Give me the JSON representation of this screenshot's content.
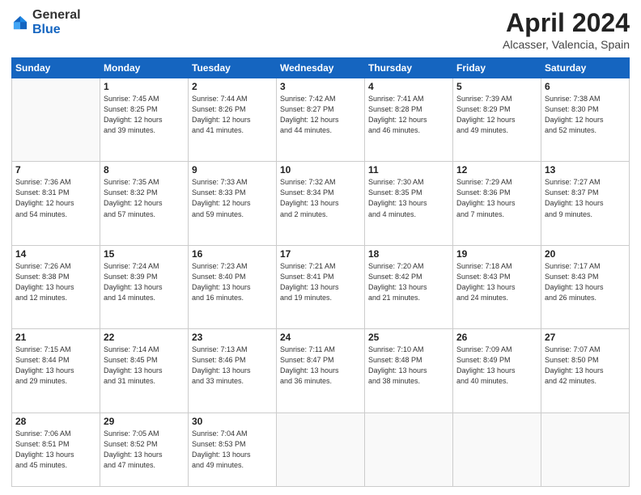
{
  "header": {
    "logo_general": "General",
    "logo_blue": "Blue",
    "month_title": "April 2024",
    "location": "Alcasser, Valencia, Spain"
  },
  "columns": [
    "Sunday",
    "Monday",
    "Tuesday",
    "Wednesday",
    "Thursday",
    "Friday",
    "Saturday"
  ],
  "weeks": [
    [
      {
        "num": "",
        "info": ""
      },
      {
        "num": "1",
        "info": "Sunrise: 7:45 AM\nSunset: 8:25 PM\nDaylight: 12 hours\nand 39 minutes."
      },
      {
        "num": "2",
        "info": "Sunrise: 7:44 AM\nSunset: 8:26 PM\nDaylight: 12 hours\nand 41 minutes."
      },
      {
        "num": "3",
        "info": "Sunrise: 7:42 AM\nSunset: 8:27 PM\nDaylight: 12 hours\nand 44 minutes."
      },
      {
        "num": "4",
        "info": "Sunrise: 7:41 AM\nSunset: 8:28 PM\nDaylight: 12 hours\nand 46 minutes."
      },
      {
        "num": "5",
        "info": "Sunrise: 7:39 AM\nSunset: 8:29 PM\nDaylight: 12 hours\nand 49 minutes."
      },
      {
        "num": "6",
        "info": "Sunrise: 7:38 AM\nSunset: 8:30 PM\nDaylight: 12 hours\nand 52 minutes."
      }
    ],
    [
      {
        "num": "7",
        "info": "Sunrise: 7:36 AM\nSunset: 8:31 PM\nDaylight: 12 hours\nand 54 minutes."
      },
      {
        "num": "8",
        "info": "Sunrise: 7:35 AM\nSunset: 8:32 PM\nDaylight: 12 hours\nand 57 minutes."
      },
      {
        "num": "9",
        "info": "Sunrise: 7:33 AM\nSunset: 8:33 PM\nDaylight: 12 hours\nand 59 minutes."
      },
      {
        "num": "10",
        "info": "Sunrise: 7:32 AM\nSunset: 8:34 PM\nDaylight: 13 hours\nand 2 minutes."
      },
      {
        "num": "11",
        "info": "Sunrise: 7:30 AM\nSunset: 8:35 PM\nDaylight: 13 hours\nand 4 minutes."
      },
      {
        "num": "12",
        "info": "Sunrise: 7:29 AM\nSunset: 8:36 PM\nDaylight: 13 hours\nand 7 minutes."
      },
      {
        "num": "13",
        "info": "Sunrise: 7:27 AM\nSunset: 8:37 PM\nDaylight: 13 hours\nand 9 minutes."
      }
    ],
    [
      {
        "num": "14",
        "info": "Sunrise: 7:26 AM\nSunset: 8:38 PM\nDaylight: 13 hours\nand 12 minutes."
      },
      {
        "num": "15",
        "info": "Sunrise: 7:24 AM\nSunset: 8:39 PM\nDaylight: 13 hours\nand 14 minutes."
      },
      {
        "num": "16",
        "info": "Sunrise: 7:23 AM\nSunset: 8:40 PM\nDaylight: 13 hours\nand 16 minutes."
      },
      {
        "num": "17",
        "info": "Sunrise: 7:21 AM\nSunset: 8:41 PM\nDaylight: 13 hours\nand 19 minutes."
      },
      {
        "num": "18",
        "info": "Sunrise: 7:20 AM\nSunset: 8:42 PM\nDaylight: 13 hours\nand 21 minutes."
      },
      {
        "num": "19",
        "info": "Sunrise: 7:18 AM\nSunset: 8:43 PM\nDaylight: 13 hours\nand 24 minutes."
      },
      {
        "num": "20",
        "info": "Sunrise: 7:17 AM\nSunset: 8:43 PM\nDaylight: 13 hours\nand 26 minutes."
      }
    ],
    [
      {
        "num": "21",
        "info": "Sunrise: 7:15 AM\nSunset: 8:44 PM\nDaylight: 13 hours\nand 29 minutes."
      },
      {
        "num": "22",
        "info": "Sunrise: 7:14 AM\nSunset: 8:45 PM\nDaylight: 13 hours\nand 31 minutes."
      },
      {
        "num": "23",
        "info": "Sunrise: 7:13 AM\nSunset: 8:46 PM\nDaylight: 13 hours\nand 33 minutes."
      },
      {
        "num": "24",
        "info": "Sunrise: 7:11 AM\nSunset: 8:47 PM\nDaylight: 13 hours\nand 36 minutes."
      },
      {
        "num": "25",
        "info": "Sunrise: 7:10 AM\nSunset: 8:48 PM\nDaylight: 13 hours\nand 38 minutes."
      },
      {
        "num": "26",
        "info": "Sunrise: 7:09 AM\nSunset: 8:49 PM\nDaylight: 13 hours\nand 40 minutes."
      },
      {
        "num": "27",
        "info": "Sunrise: 7:07 AM\nSunset: 8:50 PM\nDaylight: 13 hours\nand 42 minutes."
      }
    ],
    [
      {
        "num": "28",
        "info": "Sunrise: 7:06 AM\nSunset: 8:51 PM\nDaylight: 13 hours\nand 45 minutes."
      },
      {
        "num": "29",
        "info": "Sunrise: 7:05 AM\nSunset: 8:52 PM\nDaylight: 13 hours\nand 47 minutes."
      },
      {
        "num": "30",
        "info": "Sunrise: 7:04 AM\nSunset: 8:53 PM\nDaylight: 13 hours\nand 49 minutes."
      },
      {
        "num": "",
        "info": ""
      },
      {
        "num": "",
        "info": ""
      },
      {
        "num": "",
        "info": ""
      },
      {
        "num": "",
        "info": ""
      }
    ]
  ]
}
